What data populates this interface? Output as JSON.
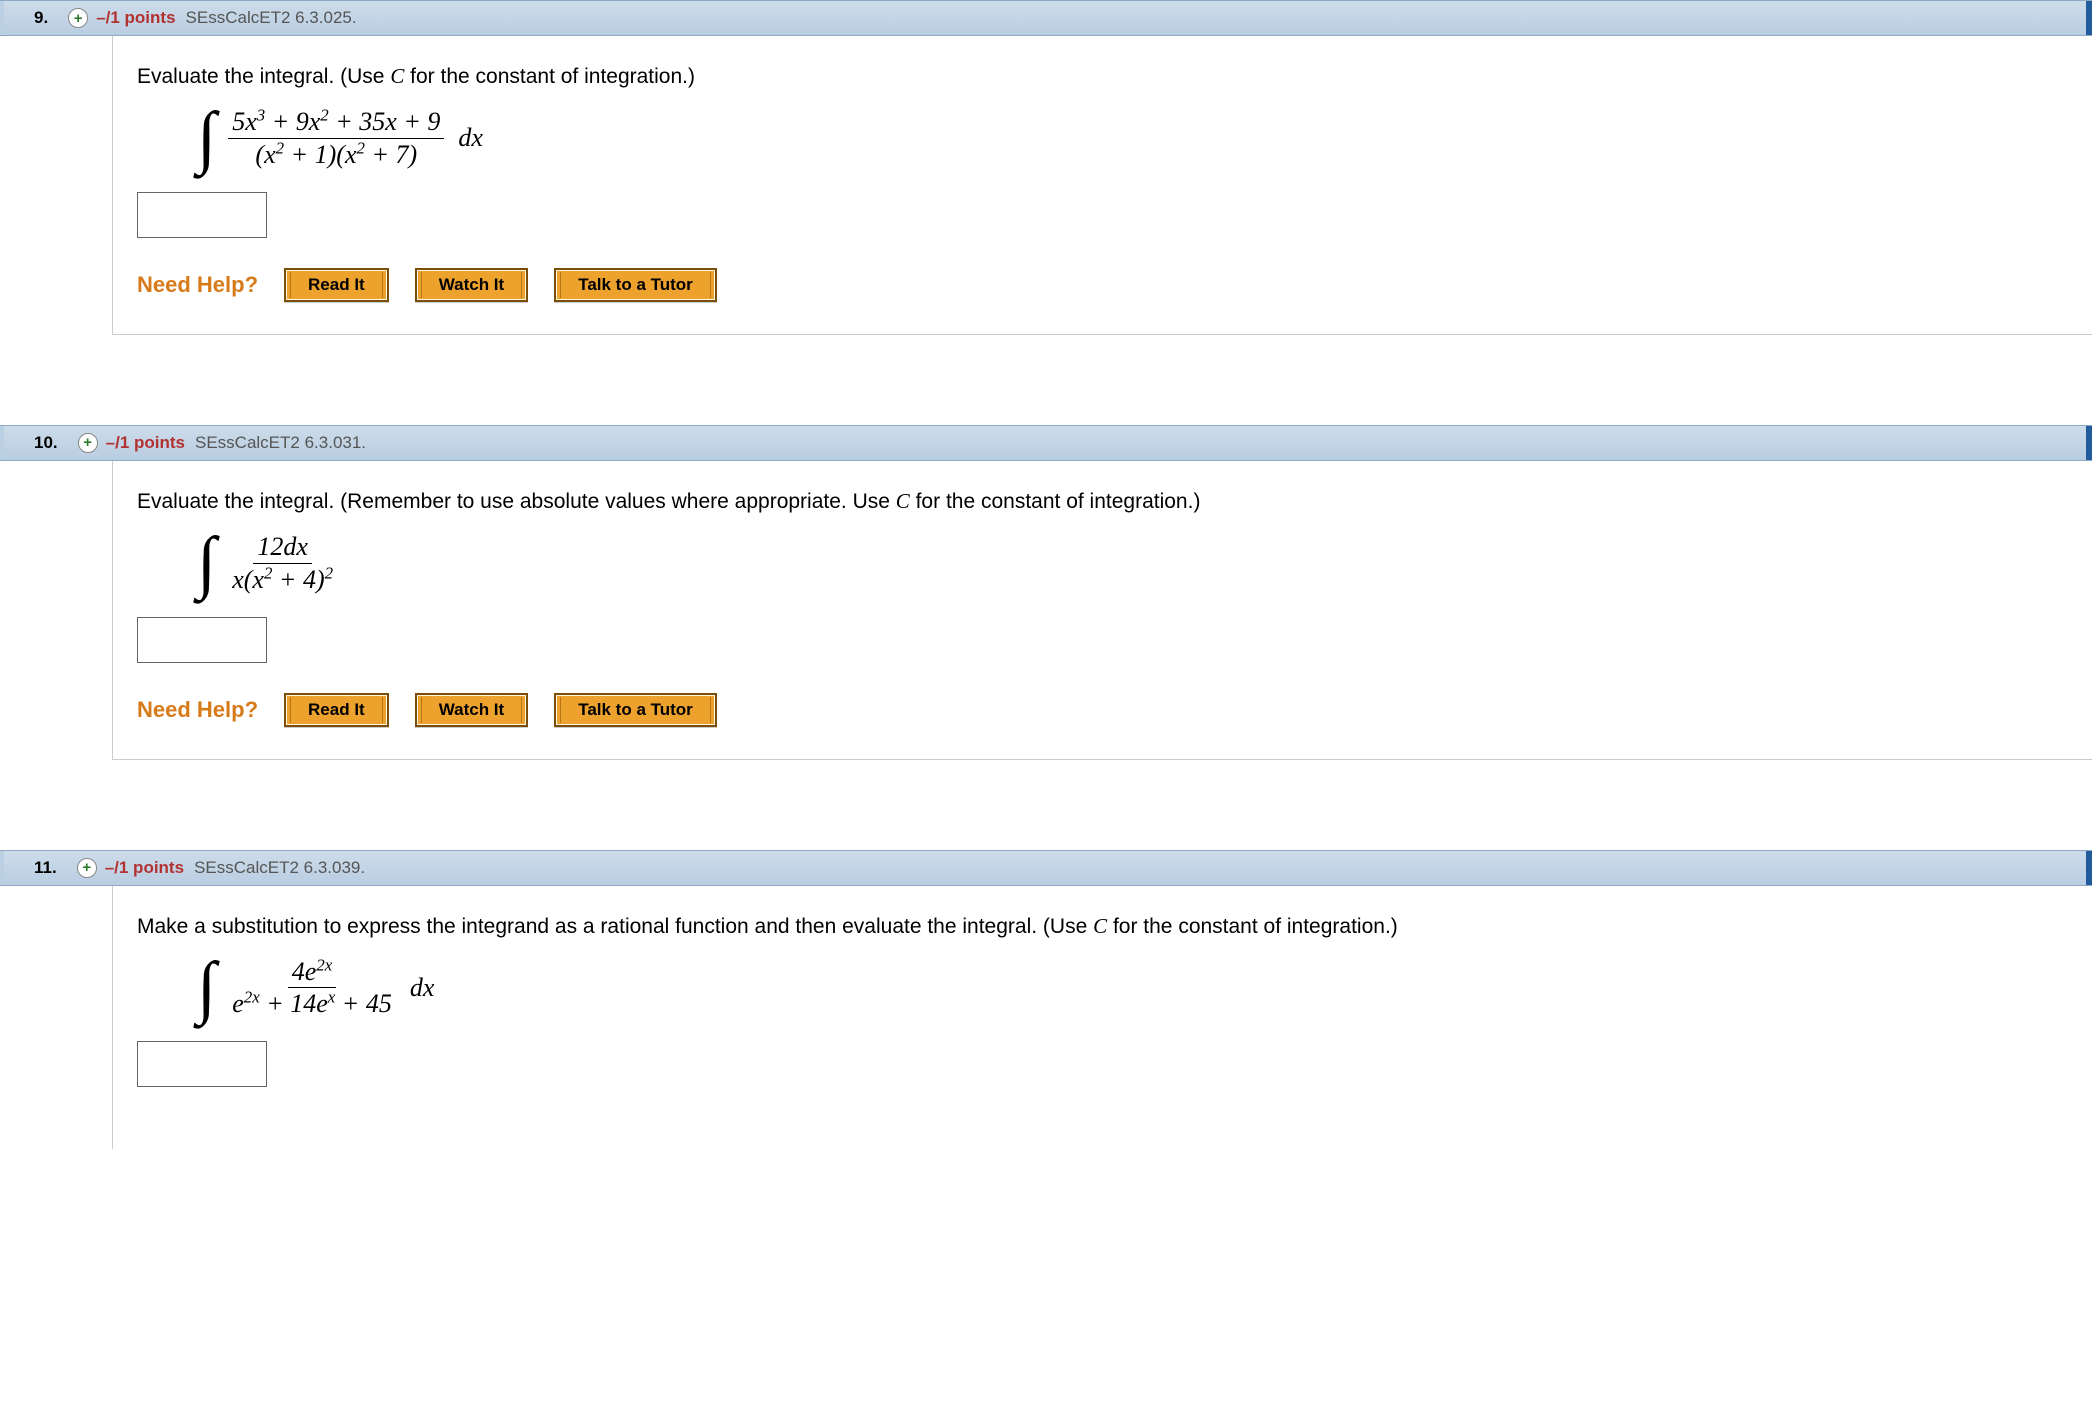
{
  "need_help_label": "Need Help?",
  "help_buttons": {
    "read": "Read It",
    "watch": "Watch It",
    "tutor": "Talk to a Tutor"
  },
  "questions": [
    {
      "number": "9.",
      "expander": "+",
      "points": "–/1 points",
      "code": "SEssCalcET2 6.3.025.",
      "prompt_pre": "Evaluate the integral. (Use ",
      "prompt_var": "C",
      "prompt_post": " for the constant of integration.)",
      "integral": {
        "numerator_html": "5<i>x</i><sup>3</sup> + 9<i>x</i><sup>2</sup> + 35<i>x</i> + 9",
        "denominator_html": "(<i>x</i><sup>2</sup> + 1)(<i>x</i><sup>2</sup> + 7)",
        "suffix": " dx"
      },
      "show_help": true
    },
    {
      "number": "10.",
      "expander": "+",
      "points": "–/1 points",
      "code": "SEssCalcET2 6.3.031.",
      "prompt_pre": "Evaluate the integral. (Remember to use absolute values where appropriate. Use ",
      "prompt_var": "C",
      "prompt_post": " for the constant of integration.)",
      "integral": {
        "numerator_html": "12<i>dx</i>",
        "denominator_html": "<i>x</i>(<i>x</i><sup>2</sup> + 4)<sup>2</sup>",
        "suffix": ""
      },
      "show_help": true
    },
    {
      "number": "11.",
      "expander": "+",
      "points": "–/1 points",
      "code": "SEssCalcET2 6.3.039.",
      "prompt_pre": "Make a substitution to express the integrand as a rational function and then evaluate the integral. (Use ",
      "prompt_var": "C",
      "prompt_post": " for the constant of integration.)",
      "integral": {
        "numerator_html": "4<i>e</i><sup>2<i>x</i></sup>",
        "denominator_html": "<i>e</i><sup>2<i>x</i></sup> + 14<i>e</i><sup><i>x</i></sup> + 45",
        "suffix": " dx"
      },
      "show_help": false
    }
  ]
}
